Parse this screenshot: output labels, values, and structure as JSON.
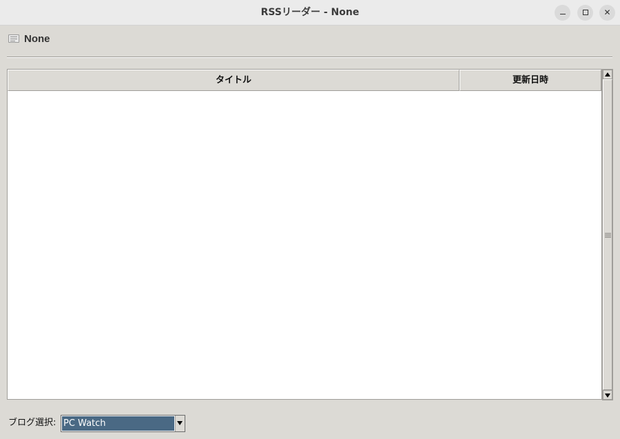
{
  "window": {
    "title": "RSSリーダー - None",
    "controls": {
      "minimize": "minimize-icon",
      "maximize": "maximize-icon",
      "close": "close-icon",
      "close_glyph": "✕"
    }
  },
  "header": {
    "icon": "newspaper-icon",
    "title": "None"
  },
  "table": {
    "columns": [
      "タイトル",
      "更新日時"
    ],
    "rows": []
  },
  "footer": {
    "blog_label": "ブログ選択:",
    "selected_blog": "PC Watch"
  },
  "colors": {
    "window_bg": "#dcdad5",
    "titlebar_bg": "#ebebeb",
    "selection_bg": "#4a6984",
    "table_bg": "#ffffff"
  }
}
